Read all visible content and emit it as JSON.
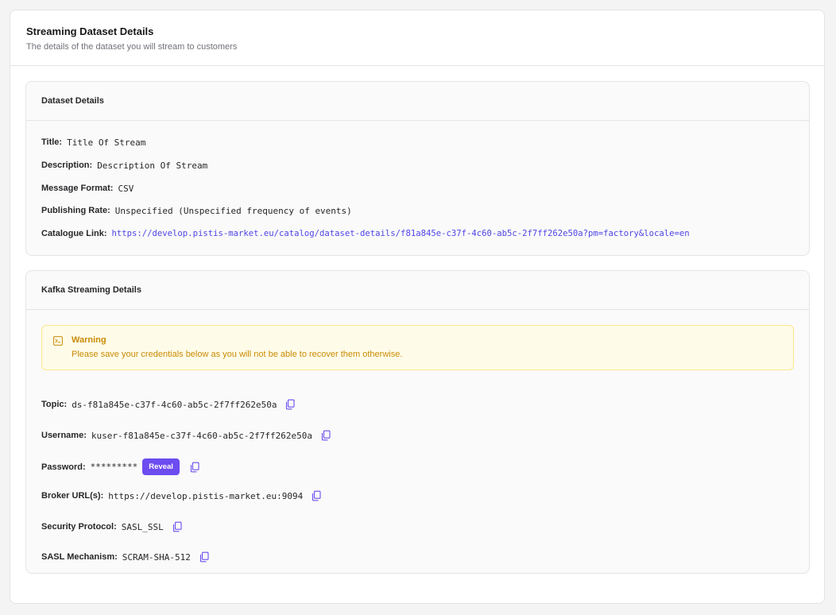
{
  "page": {
    "title": "Streaming Dataset Details",
    "subtitle": "The details of the dataset you will stream to customers"
  },
  "dataset": {
    "header": "Dataset Details",
    "title_label": "Title:",
    "title_value": "Title Of Stream",
    "description_label": "Description:",
    "description_value": "Description Of Stream",
    "format_label": "Message Format:",
    "format_value": "CSV",
    "rate_label": "Publishing Rate:",
    "rate_value": "Unspecified (Unspecified frequency of events)",
    "link_label": "Catalogue Link:",
    "link_value": "https://develop.pistis-market.eu/catalog/dataset-details/f81a845e-c37f-4c60-ab5c-2f7ff262e50a?pm=factory&locale=en"
  },
  "kafka": {
    "header": "Kafka Streaming Details",
    "warning_title": "Warning",
    "warning_text": "Please save your credentials below as you will not be able to recover them otherwise.",
    "topic_label": "Topic:",
    "topic_value": "ds-f81a845e-c37f-4c60-ab5c-2f7ff262e50a",
    "username_label": "Username:",
    "username_value": "kuser-f81a845e-c37f-4c60-ab5c-2f7ff262e50a",
    "password_label": "Password:",
    "password_value": "*********",
    "reveal_label": "Reveal",
    "broker_label": "Broker URL(s):",
    "broker_value": "https://develop.pistis-market.eu:9094",
    "protocol_label": "Security Protocol:",
    "protocol_value": "SASL_SSL",
    "mechanism_label": "SASL Mechanism:",
    "mechanism_value": "SCRAM-SHA-512"
  },
  "icons": {
    "copy": "copy-icon",
    "warning": "terminal-icon"
  },
  "colors": {
    "accent": "#6d4cf0",
    "link": "#4f46e5",
    "warning_text": "#ca8a04",
    "warning_bg": "#fefce8"
  }
}
